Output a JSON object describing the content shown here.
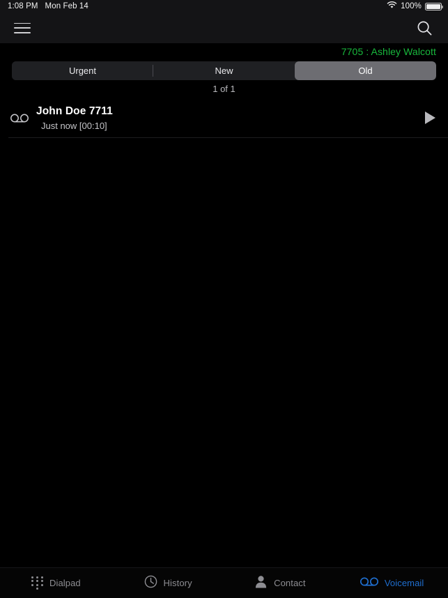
{
  "status_bar": {
    "time": "1:08 PM",
    "date": "Mon Feb 14",
    "battery_percent": "100%",
    "wifi_icon": "wifi-icon",
    "battery_icon": "battery-icon"
  },
  "nav_bar": {
    "menu_icon": "hamburger-menu-icon",
    "search_icon": "search-icon"
  },
  "account": {
    "label": "7705 : Ashley Walcott",
    "color": "#18b83c"
  },
  "segmented_control": {
    "options": [
      {
        "label": "Urgent",
        "selected": false
      },
      {
        "label": "New",
        "selected": false
      },
      {
        "label": "Old",
        "selected": true
      }
    ],
    "selected_bg": "#6d6d72",
    "track_bg": "#1f2023"
  },
  "counter": {
    "text": "1 of 1"
  },
  "voicemails": [
    {
      "icon": "voicemail-icon",
      "name": "John Doe 7711",
      "subtitle": "Just now  [00:10]",
      "play_icon": "play-icon"
    }
  ],
  "tab_bar": {
    "active_color": "#1f6fd0",
    "inactive_color": "#8e8e93",
    "tabs": [
      {
        "label": "Dialpad",
        "icon": "dialpad-icon",
        "active": false
      },
      {
        "label": "History",
        "icon": "clock-icon",
        "active": false
      },
      {
        "label": "Contact",
        "icon": "person-icon",
        "active": false
      },
      {
        "label": "Voicemail",
        "icon": "voicemail-icon",
        "active": true
      }
    ]
  }
}
